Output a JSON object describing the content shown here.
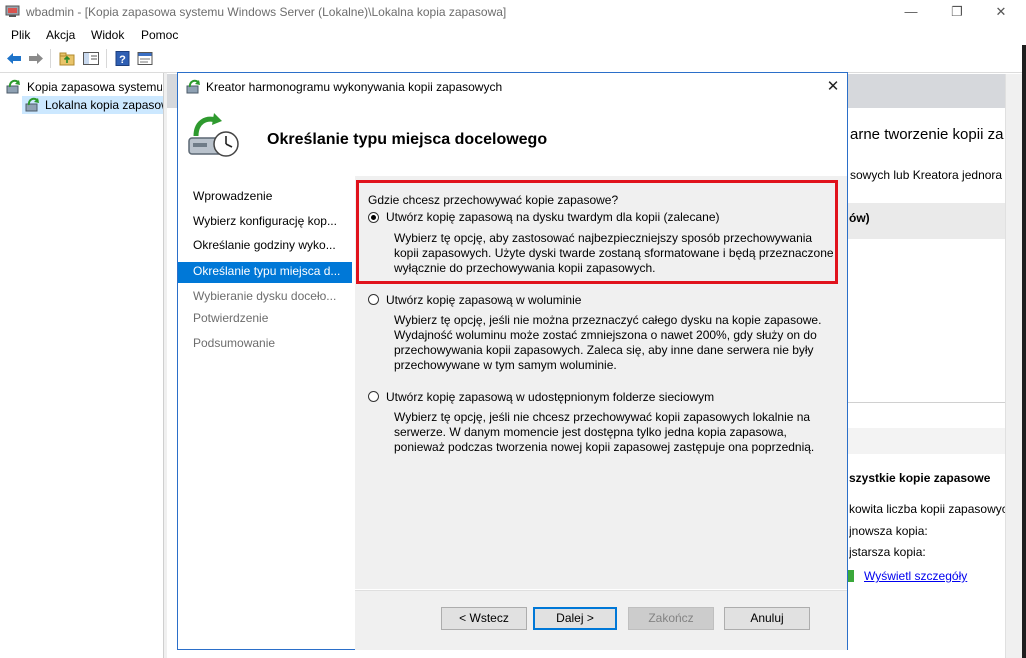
{
  "window": {
    "title": "wbadmin - [Kopia zapasowa systemu Windows Server (Lokalne)\\Lokalna kopia zapasowa]"
  },
  "menu": [
    "Plik",
    "Akcja",
    "Widok",
    "Pomoc"
  ],
  "tree": {
    "root": "Kopia zapasowa systemu Windows Server (Lokalne)",
    "child": "Lokalna kopia zapasowa"
  },
  "background": {
    "header_frag": "arne tworzenie kopii za",
    "desc_frag": "sowych lub Kreatora jednora",
    "col_frag": "ów)",
    "section_title": "szystkie kopie zapasowe",
    "total_label": "kowita liczba kopii zapasowyc",
    "newest_label": "jnowsza kopia:",
    "oldest_label": "jstarsza kopia:",
    "details_link": "Wyświetl szczegóły"
  },
  "dialog": {
    "title": "Kreator harmonogramu wykonywania kopii zapasowych",
    "heading": "Określanie typu miejsca docelowego",
    "nav": [
      {
        "label": "Wprowadzenie"
      },
      {
        "label": "Wybierz konfigurację kop..."
      },
      {
        "label": "Określanie godziny wyko..."
      },
      {
        "label": "Określanie typu miejsca d..."
      },
      {
        "label": "Wybieranie dysku doceło..."
      },
      {
        "label": "Potwierdzenie"
      },
      {
        "label": "Podsumowanie"
      }
    ],
    "question": "Gdzie chcesz przechowywać kopie zapasowe?",
    "options": [
      {
        "label": "Utwórz kopię zapasową na dysku twardym dla kopii (zalecane)",
        "desc": "Wybierz tę opcję, aby zastosować najbezpieczniejszy sposób przechowywania kopii zapasowych. Użyte dyski twarde zostaną sformatowane i będą przeznaczone wyłącznie do przechowywania kopii zapasowych.",
        "selected": true
      },
      {
        "label": "Utwórz kopię zapasową w woluminie",
        "desc": "Wybierz tę opcję, jeśli nie można przeznaczyć całego dysku na kopie zapasowe. Wydajność woluminu może zostać zmniejszona o nawet 200%, gdy służy on do przechowywania kopii zapasowych. Zaleca się, aby inne dane serwera nie były przechowywane w tym samym woluminie.",
        "selected": false
      },
      {
        "label": "Utwórz kopię zapasową w udostępnionym folderze sieciowym",
        "desc": "Wybierz tę opcję, jeśli nie chcesz przechowywać kopii zapasowych lokalnie na serwerze. W danym momencie jest dostępna tylko jedna kopia zapasowa, ponieważ podczas tworzenia nowej kopii zapasowej zastępuje ona poprzednią.",
        "selected": false
      }
    ],
    "buttons": {
      "back": "< Wstecz",
      "next": "Dalej >",
      "finish": "Zakończ",
      "cancel": "Anuluj"
    }
  },
  "colors": {
    "accent": "#0078d7",
    "highlight_border": "#e0121c",
    "link": "#0000ee"
  }
}
